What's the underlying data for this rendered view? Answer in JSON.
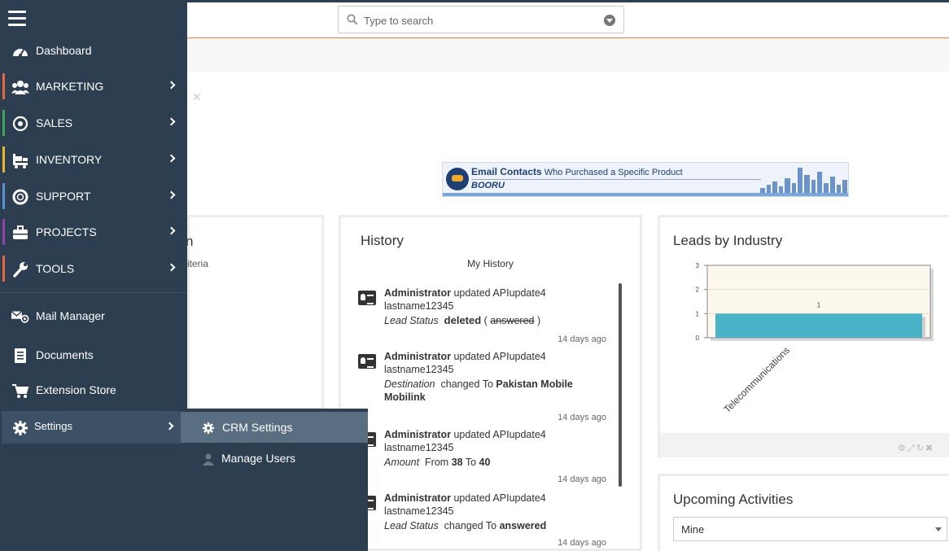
{
  "search": {
    "placeholder": "Type to search"
  },
  "sidebar": {
    "items": [
      {
        "label": "Dashboard",
        "icon": "dashboard-icon",
        "accent": ""
      },
      {
        "label": "MARKETING",
        "icon": "users-icon",
        "accent": "#e5673e"
      },
      {
        "label": "SALES",
        "icon": "target-icon",
        "accent": "#3ba55c"
      },
      {
        "label": "INVENTORY",
        "icon": "cart-icon",
        "accent": "#e6b82e"
      },
      {
        "label": "SUPPORT",
        "icon": "lifebuoy-icon",
        "accent": "#5b8fd6"
      },
      {
        "label": "PROJECTS",
        "icon": "briefcase-icon",
        "accent": "#8e44ad"
      },
      {
        "label": "TOOLS",
        "icon": "wrench-icon",
        "accent": "#e5673e"
      }
    ],
    "extras": [
      {
        "label": "Mail Manager",
        "icon": "mail-at-icon"
      },
      {
        "label": "Documents",
        "icon": "document-icon"
      },
      {
        "label": "Extension Store",
        "icon": "cart-icon"
      },
      {
        "label": "Settings",
        "icon": "gear-icon"
      }
    ]
  },
  "settings_menu": {
    "items": [
      {
        "label": "CRM Settings",
        "icon": "gear-icon"
      },
      {
        "label": "Manage Users",
        "icon": "user-icon"
      }
    ]
  },
  "banner": {
    "headline": "Email Contacts",
    "tagline": "Who Purchased a Specific Product",
    "brand": "BOORU"
  },
  "left_widget": {
    "title_tail": "n",
    "subtitle_tail": "iteria"
  },
  "history": {
    "title": "History",
    "subtitle": "My History",
    "entries": [
      {
        "actor": "Administrator",
        "verb": "updated",
        "record": "APIupdate4 lastname12345",
        "field": "Lead Status",
        "action": "deleted",
        "old": "answered",
        "time": "14 days ago"
      },
      {
        "actor": "Administrator",
        "verb": "updated",
        "record": "APIupdate4 lastname12345",
        "field": "Destination",
        "action_text": "changed To",
        "new": "Pakistan Mobile Mobilink",
        "time": "14 days ago"
      },
      {
        "actor": "Administrator",
        "verb": "updated",
        "record": "APIupdate4 lastname12345",
        "field": "Amount",
        "from_text": "From",
        "from": "38",
        "to_text": "To",
        "to": "40",
        "time": "14 days ago"
      },
      {
        "actor": "Administrator",
        "verb": "updated",
        "record": "APIupdate4 lastname12345",
        "field": "Lead Status",
        "action_text": "changed To",
        "new": "answered",
        "time": "14 days ago"
      }
    ]
  },
  "leads": {
    "title": "Leads by Industry"
  },
  "chart_data": {
    "type": "bar",
    "title": "Leads by Industry",
    "categories": [
      "Telecommunications"
    ],
    "values": [
      1
    ],
    "ylim": [
      0,
      3
    ],
    "yticks": [
      0,
      1,
      2,
      3
    ],
    "data_labels": [
      "1"
    ],
    "bar_color": "#4bb3c8",
    "xlabel": "",
    "ylabel": ""
  },
  "upcoming": {
    "title": "Upcoming Activities",
    "selected": "Mine"
  }
}
